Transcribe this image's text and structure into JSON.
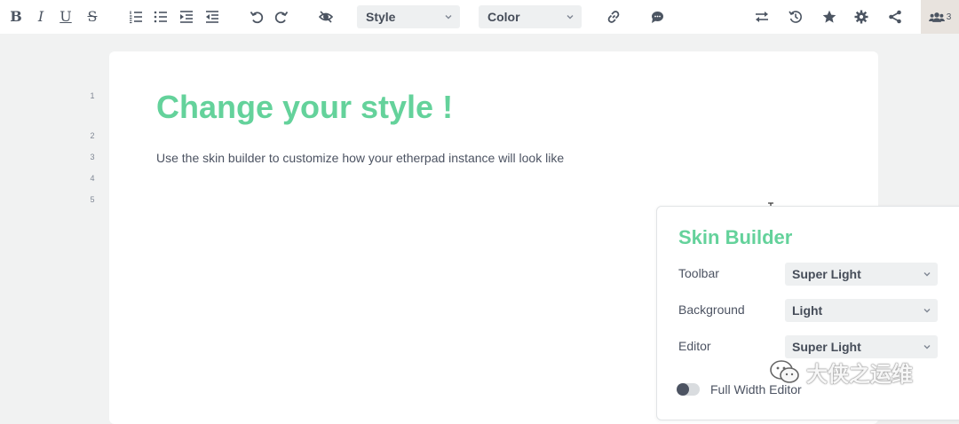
{
  "toolbar": {
    "bold": "B",
    "italic": "I",
    "underline": "U",
    "strike": "S",
    "style_label": "Style",
    "color_label": "Color",
    "user_count": "3"
  },
  "editor": {
    "line_numbers": [
      "1",
      "2",
      "3",
      "4",
      "5"
    ],
    "heading": "Change your style !",
    "paragraph": "Use the skin builder to customize how your etherpad instance will look like"
  },
  "skin_builder": {
    "title": "Skin Builder",
    "rows": [
      {
        "label": "Toolbar",
        "value": "Super Light"
      },
      {
        "label": "Background",
        "value": "Light"
      },
      {
        "label": "Editor",
        "value": "Super Light"
      }
    ],
    "full_width_label": "Full Width Editor"
  },
  "watermark": {
    "text": "大侠之运维"
  },
  "colors": {
    "accent": "#64d29b",
    "icon": "#4c5562",
    "background": "#f1f2f2"
  }
}
